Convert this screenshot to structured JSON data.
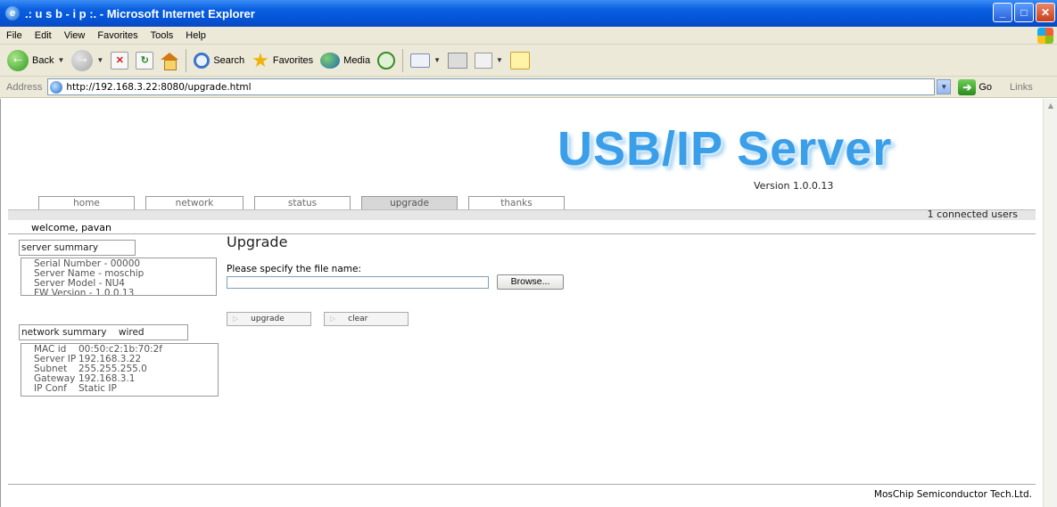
{
  "window": {
    "title": ".: u s b - i p :. - Microsoft Internet Explorer",
    "minimize": "_",
    "maximize": "□",
    "close": "✕"
  },
  "menu": [
    "File",
    "Edit",
    "View",
    "Favorites",
    "Tools",
    "Help"
  ],
  "toolbar": {
    "back": "Back",
    "search": "Search",
    "favorites": "Favorites",
    "media": "Media"
  },
  "address": {
    "label": "Address",
    "url": "http://192.168.3.22:8080/upgrade.html",
    "go": "Go",
    "links": "Links"
  },
  "page": {
    "logo": "USB/IP Server",
    "version": "Version 1.0.0.13",
    "tabs": [
      {
        "label": "home",
        "active": false
      },
      {
        "label": "network",
        "active": false
      },
      {
        "label": "status",
        "active": false
      },
      {
        "label": "upgrade",
        "active": true
      },
      {
        "label": "thanks",
        "active": false
      }
    ],
    "connected_users": "1 connected users",
    "welcome": "welcome, pavan",
    "server_summary": {
      "title": "server summary",
      "lines": [
        "Serial Number - 00000",
        "Server Name - moschip",
        "Server Model - NU4",
        "FW Version - 1.0.0.13"
      ]
    },
    "network_summary": {
      "title": "network summary",
      "mode": "wired",
      "rows": [
        {
          "k": "MAC id",
          "v": "00:50:c2:1b:70:2f"
        },
        {
          "k": "Server IP",
          "v": "192.168.3.22"
        },
        {
          "k": "Subnet",
          "v": "255.255.255.0"
        },
        {
          "k": "Gateway",
          "v": "192.168.3.1"
        },
        {
          "k": "IP Conf",
          "v": "Static IP"
        }
      ]
    },
    "upgrade": {
      "heading": "Upgrade",
      "prompt": "Please specify the file name:",
      "file_value": "",
      "browse": "Browse...",
      "upgrade_btn": "upgrade",
      "clear_btn": "clear"
    },
    "footer": "MosChip Semiconductor Tech.Ltd."
  },
  "colors": {
    "titlebar": "#0a5fe0",
    "logo": "#3a9ee8",
    "chrome": "#ece9d8"
  }
}
